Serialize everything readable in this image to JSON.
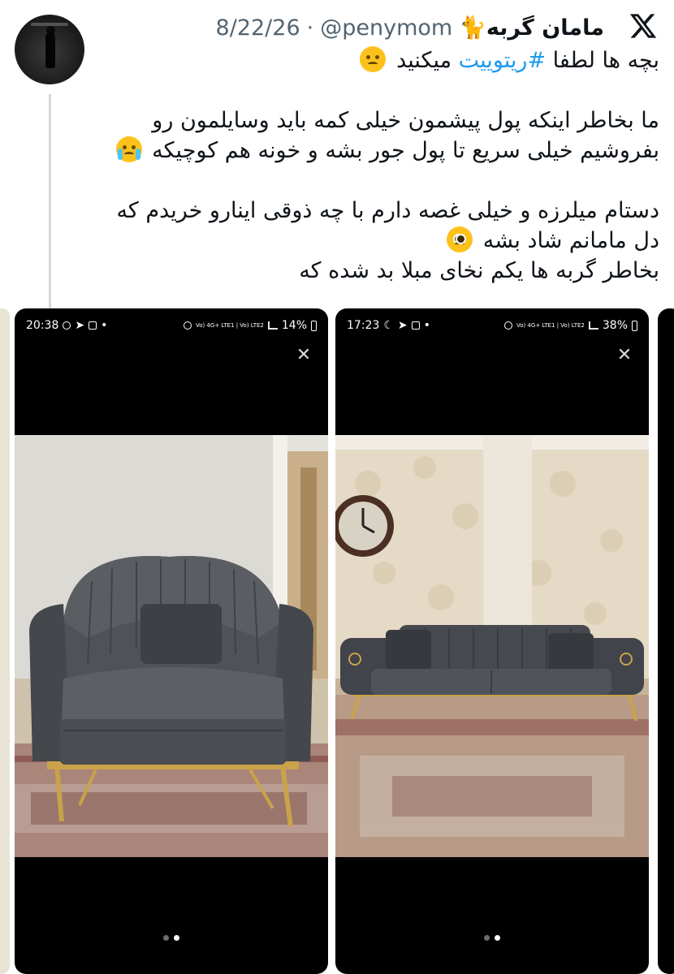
{
  "tweet": {
    "display_name": "مامان گربه🐈",
    "handle": "@penymom",
    "separator": "·",
    "date": "8/22/26",
    "line1_text": "بچه ها لطفا ",
    "line1_hashtag": "#ریتوییت",
    "line1_after": " میکنید",
    "line2": "ما بخاطر اینکه پول پیشمون خیلی کمه باید وسایلمون رو",
    "line3": "بفروشیم خیلی سریع تا پول جور بشه و خونه هم کوچیکه",
    "line4": "دستام میلرزه و خیلی غصه دارم با چه ذوقی اینارو خریدم که",
    "line5": "دل مامانم شاد بشه",
    "line6": "بخاطر گربه ها یکم نخای مبلا بد شده که"
  },
  "icons": {
    "platform_logo": "x-logo-icon",
    "emoji_1": "disappointed-face-icon",
    "emoji_2": "loudly-crying-face-icon",
    "emoji_3": "pleading-face-icon"
  },
  "media": [
    {
      "time": "20:38",
      "battery": "14%",
      "network": "Vo) 4G+ LTE1 | Vo) LTE2",
      "close_glyph": "✕",
      "subject": "armchair"
    },
    {
      "time": "17:23",
      "battery": "38%",
      "network": "Vo) 4G+ LTE1 | Vo) LTE2",
      "close_glyph": "✕",
      "subject": "sofa"
    }
  ],
  "colors": {
    "hashtag": "#1d9bf0",
    "secondary_text": "#536471",
    "thread_line": "#cfd9de",
    "upholstery": "#474a4f",
    "gold_legs": "#c9a24a"
  }
}
